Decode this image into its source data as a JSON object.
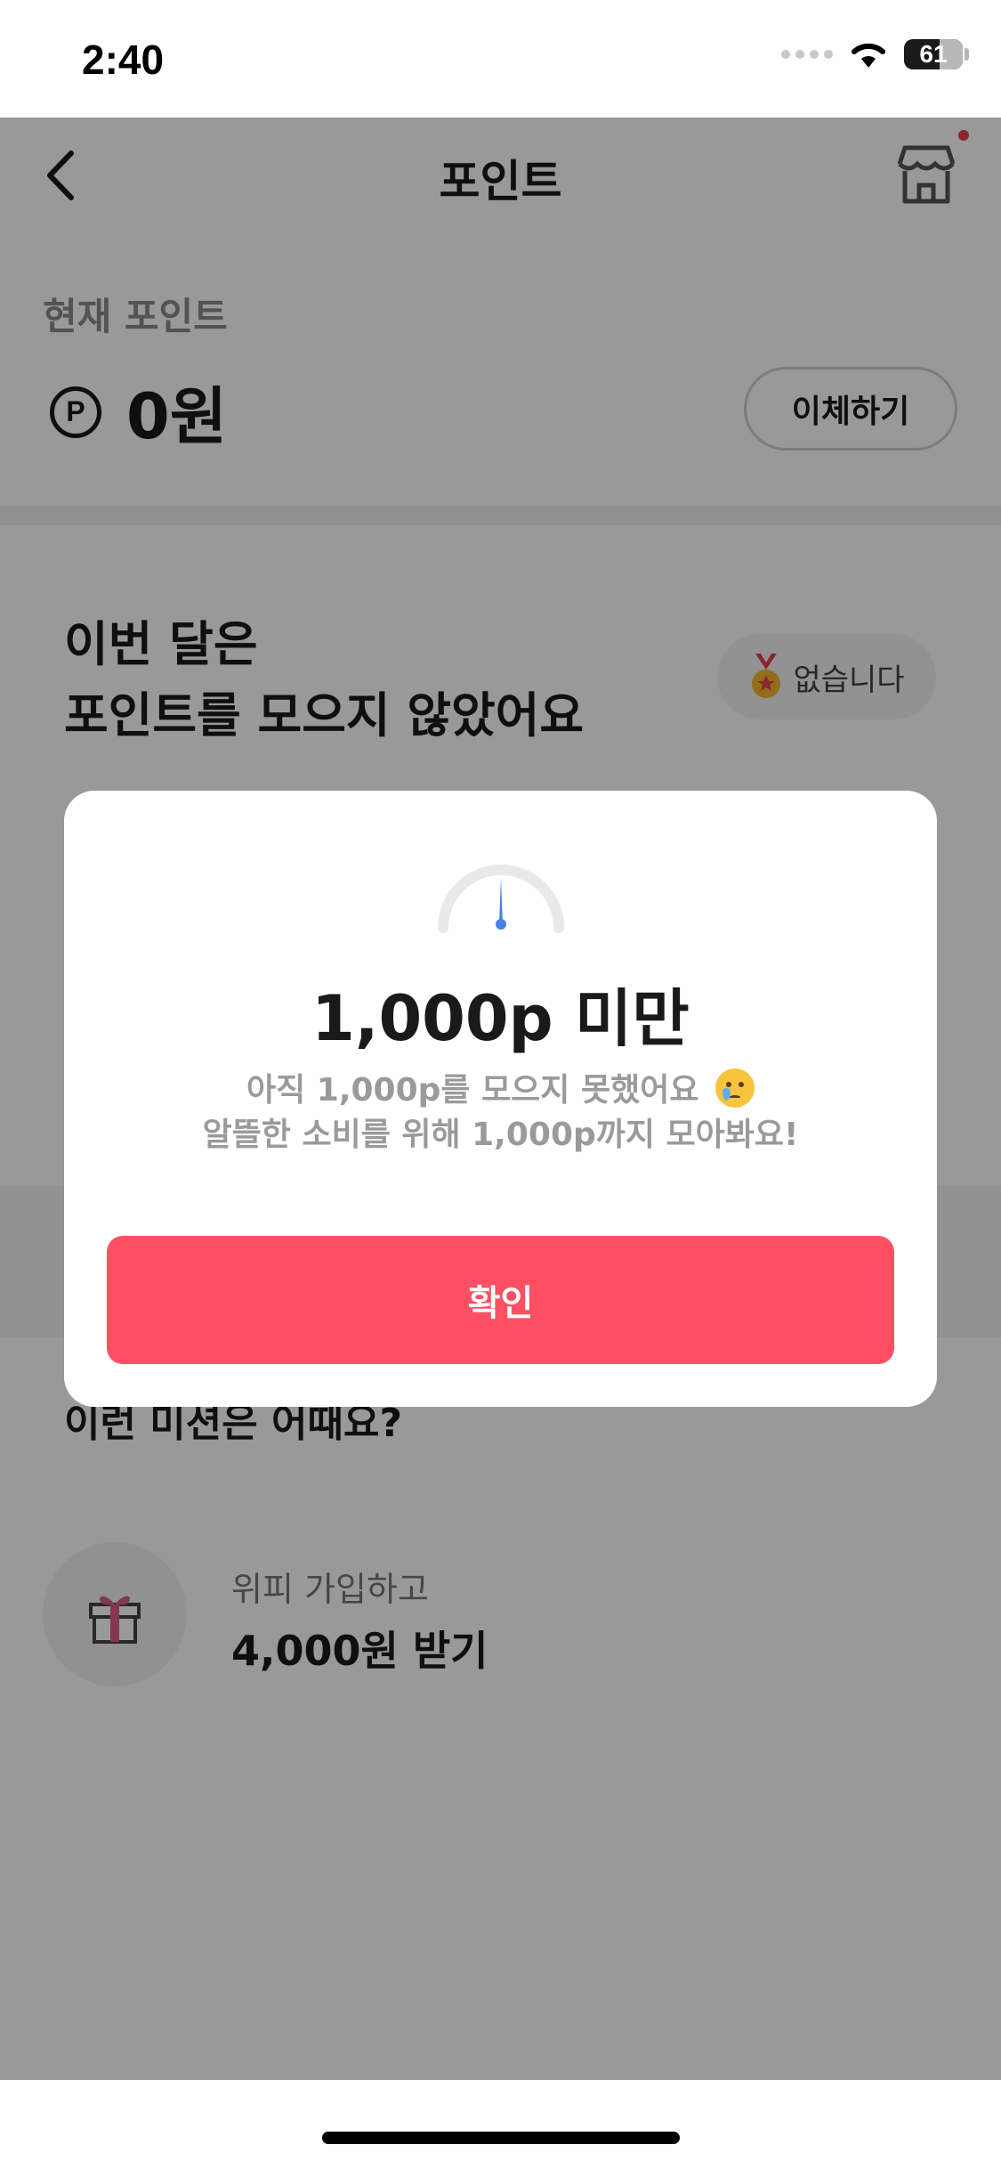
{
  "status_bar": {
    "time": "2:40",
    "battery": "61"
  },
  "nav": {
    "title": "포인트"
  },
  "points": {
    "label": "현재 포인트",
    "symbol": "P",
    "value": "0원",
    "transfer_label": "이체하기"
  },
  "monthly": {
    "line1": "이번 달은",
    "line2": "포인트를 모으지 않았어요",
    "badge_label": "없습니다"
  },
  "missions": {
    "title": "이런 미션은 어때요?",
    "items": [
      {
        "subtitle": "위피 가입하고",
        "title": "4,000원 받기",
        "icon": "gift-icon"
      }
    ]
  },
  "modal": {
    "title": "1,000p 미만",
    "desc_line1": "아직 1,000p를 모으지 못했어요",
    "desc_line2": "알뜰한 소비를 위해 1,000p까지 모아봐요!",
    "confirm_label": "확인",
    "gauge_level": 0
  },
  "colors": {
    "accent": "#ff4f62",
    "gauge_needle": "#4a7fe6",
    "notification_dot": "#e4404d"
  }
}
